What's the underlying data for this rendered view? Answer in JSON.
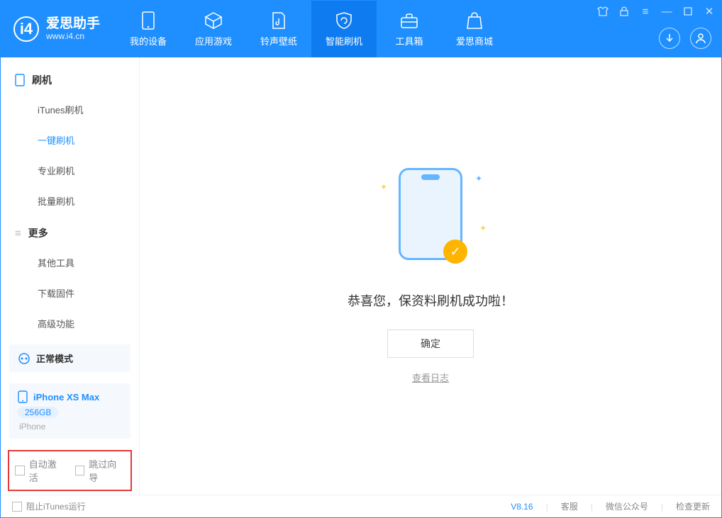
{
  "brand": {
    "name": "爱思助手",
    "url": "www.i4.cn"
  },
  "nav": [
    {
      "label": "我的设备"
    },
    {
      "label": "应用游戏"
    },
    {
      "label": "铃声壁纸"
    },
    {
      "label": "智能刷机"
    },
    {
      "label": "工具箱"
    },
    {
      "label": "爱思商城"
    }
  ],
  "sidebar": {
    "section1_title": "刷机",
    "section1_items": [
      "iTunes刷机",
      "一键刷机",
      "专业刷机",
      "批量刷机"
    ],
    "section2_title": "更多",
    "section2_items": [
      "其他工具",
      "下载固件",
      "高级功能"
    ]
  },
  "mode_card": {
    "label": "正常模式"
  },
  "device_card": {
    "name": "iPhone XS Max",
    "storage": "256GB",
    "type": "iPhone"
  },
  "red_box": {
    "opt1": "自动激活",
    "opt2": "跳过向导"
  },
  "main": {
    "success_text": "恭喜您，保资料刷机成功啦！",
    "ok_button": "确定",
    "view_log": "查看日志"
  },
  "footer": {
    "block_itunes": "阻止iTunes运行",
    "version": "V8.16",
    "support": "客服",
    "wechat": "微信公众号",
    "update": "检查更新"
  }
}
